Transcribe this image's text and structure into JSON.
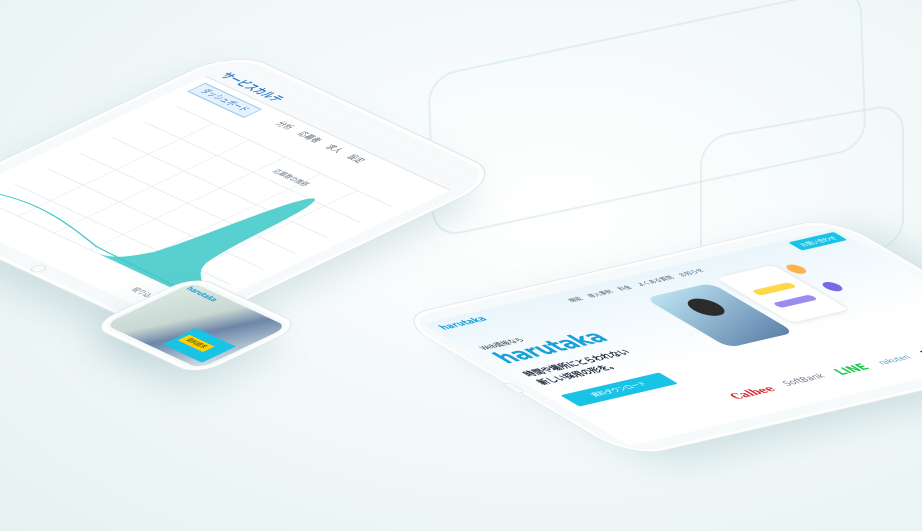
{
  "analytics": {
    "app_name": "サービスカルテ",
    "nav_tab": "ダッシュボード",
    "chart_label": "応募数の推移",
    "filter_label": "絞り込み",
    "menu_items": [
      "分析",
      "応募者",
      "求人",
      "設定"
    ]
  },
  "landing": {
    "brand": "harutaka",
    "tagline": "Web面接なら",
    "headline_line1": "時間や場所にとらわれない",
    "headline_line2": "新しい採用の形を。",
    "cta_label": "資料ダウンロード",
    "top_cta": "お問い合わせ",
    "nav_items": [
      "機能",
      "導入事例",
      "料金",
      "よくある質問",
      "お知らせ"
    ],
    "client_logos": [
      "Calbee",
      "SoftBank",
      "LINE",
      "rakuten",
      "mercari"
    ]
  },
  "phone": {
    "brand": "harutaka",
    "cta_label": "資料請求"
  },
  "colors": {
    "accent": "#3cc8c8",
    "brand_blue": "#1aa0d8",
    "cta_cyan": "#19c3e6",
    "calbee_red": "#d8262f",
    "line_green": "#1ec84a"
  }
}
